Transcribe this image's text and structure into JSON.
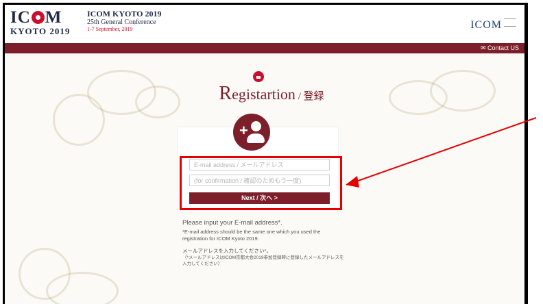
{
  "header": {
    "logo_line1_a": "IC",
    "logo_line1_b": "M",
    "logo_line2": "KYOTO 2019",
    "conf_title": "ICOM KYOTO 2019",
    "conf_subtitle": "25th General Conference",
    "conf_dates": "1-7 September, 2019",
    "right_logo": "ICOM"
  },
  "nav": {
    "contact_label": "✉ Contact US"
  },
  "page": {
    "title_big": "R",
    "title_rest": "egistartion",
    "title_sep": " / ",
    "title_jp": "登録"
  },
  "form": {
    "email_placeholder": "E-mail address / メールアドレス",
    "confirm_placeholder": "(for confirmation / 確認のためもう一度)",
    "next_label": "Next / 次へ  >"
  },
  "instructions": {
    "p1": "Please input your E-mail address*.",
    "p2": "*E-mail address should be the same one which you used the registration for ICOM Kyoto 2019.",
    "p3": "メールアドレスを入力してください*。",
    "p4": "（*メールアドレスはICOM京都大会2019参加登録時に登録したメールアドレスを入力してください）"
  },
  "colors": {
    "brand": "#7c1f2a",
    "accent_red": "#c8102e",
    "annotation": "#e50000"
  }
}
